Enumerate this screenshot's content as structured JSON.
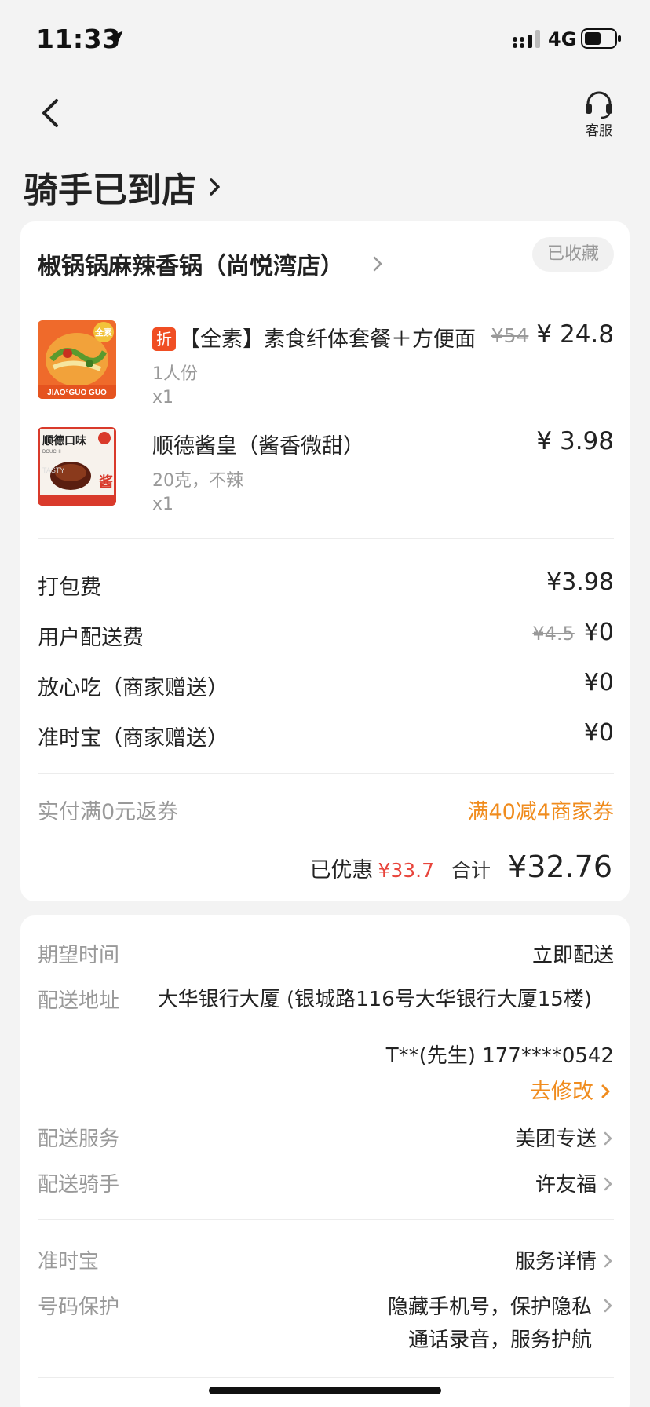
{
  "status_bar": {
    "time": "11:33",
    "network": "4G"
  },
  "header": {
    "customer_service_label": "客服",
    "page_title": "骑手已到店"
  },
  "store": {
    "name": "椒锅锅麻辣香锅（尚悦湾店）",
    "favorite_badge": "已收藏"
  },
  "items": [
    {
      "discount_tag": "折",
      "title": "【全素】素食纤体套餐＋方便面",
      "spec": "1人份",
      "qty": "x1",
      "original_price": "¥54",
      "price": "¥ 24.8",
      "thumb_badge": "全素",
      "thumb_caption": "JIAO°GUO GUO"
    },
    {
      "title": "顺德酱皇（酱香微甜）",
      "spec": "20克，不辣",
      "qty": "x1",
      "price": "¥ 3.98",
      "thumb_title": "顺德口味",
      "thumb_sub": "DOUCHI",
      "thumb_big": "酱",
      "thumb_tasty": "TASTY"
    }
  ],
  "fees": [
    {
      "label": "打包费",
      "value": "¥3.98"
    },
    {
      "label": "用户配送费",
      "original": "¥4.5",
      "value": "¥0"
    },
    {
      "label": "放心吃（商家赠送）",
      "value": "¥0"
    },
    {
      "label": "准时宝（商家赠送）",
      "value": "¥0"
    }
  ],
  "rebate": {
    "label": "实付满0元返券",
    "value": "满40减4商家券"
  },
  "summary": {
    "saved_label": "已优惠",
    "saved_value": "¥33.7",
    "total_label": "合计",
    "total_value": "¥32.76"
  },
  "delivery": {
    "expected_time_label": "期望时间",
    "expected_time_value": "立即配送",
    "address_label": "配送地址",
    "address_value": "大华银行大厦 (银城路116号大华银行大厦15楼)",
    "contact": "T**(先生) 177****0542",
    "edit_link": "去修改",
    "service_label": "配送服务",
    "service_value": "美团专送",
    "rider_label": "配送骑手",
    "rider_value": "许友福",
    "ontime_label": "准时宝",
    "ontime_value": "服务详情",
    "privacy_label": "号码保护",
    "privacy_line1": "隐藏手机号，保护隐私",
    "privacy_line2": "通话录音，服务护航"
  },
  "colors": {
    "accent_orange": "#f08c1e",
    "discount_red": "#e8453c",
    "tag_red": "#f04e23"
  }
}
